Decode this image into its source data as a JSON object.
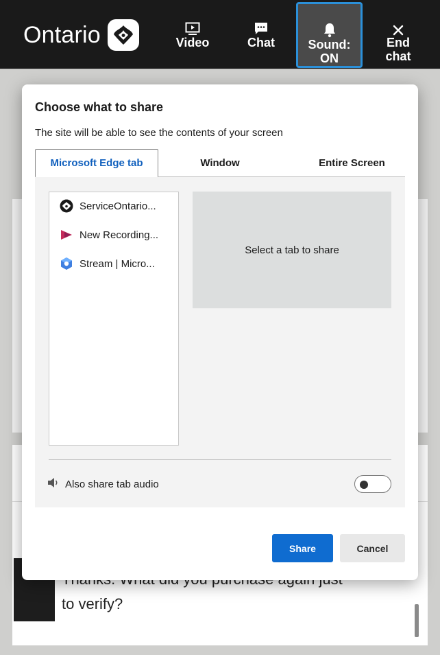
{
  "header": {
    "logo_text": "Ontario",
    "nav": {
      "video": "Video",
      "chat": "Chat",
      "sound_line1": "Sound:",
      "sound_line2": "ON",
      "end_line1": "End",
      "end_line2": "chat"
    }
  },
  "background": {
    "message_line1": "Thanks. What did you purchase again just",
    "message_line2": "to verify?"
  },
  "dialog": {
    "title": "Choose what to share",
    "subtitle": "The site will be able to see the contents of your screen",
    "tabs": [
      "Microsoft Edge tab",
      "Window",
      "Entire Screen"
    ],
    "tab_list": [
      {
        "label": "ServiceOntario...",
        "icon": "ontario-trillium-icon"
      },
      {
        "label": "New Recording...",
        "icon": "clipchamp-icon"
      },
      {
        "label": "Stream | Micro...",
        "icon": "stream-icon"
      }
    ],
    "preview_text": "Select a tab to share",
    "audio_label": "Also share tab audio",
    "audio_enabled": false,
    "share_button": "Share",
    "cancel_button": "Cancel"
  },
  "colors": {
    "accent": "#0f6cd0",
    "header_bg": "#1a1a1a",
    "sound_focus": "#2b90d9"
  }
}
